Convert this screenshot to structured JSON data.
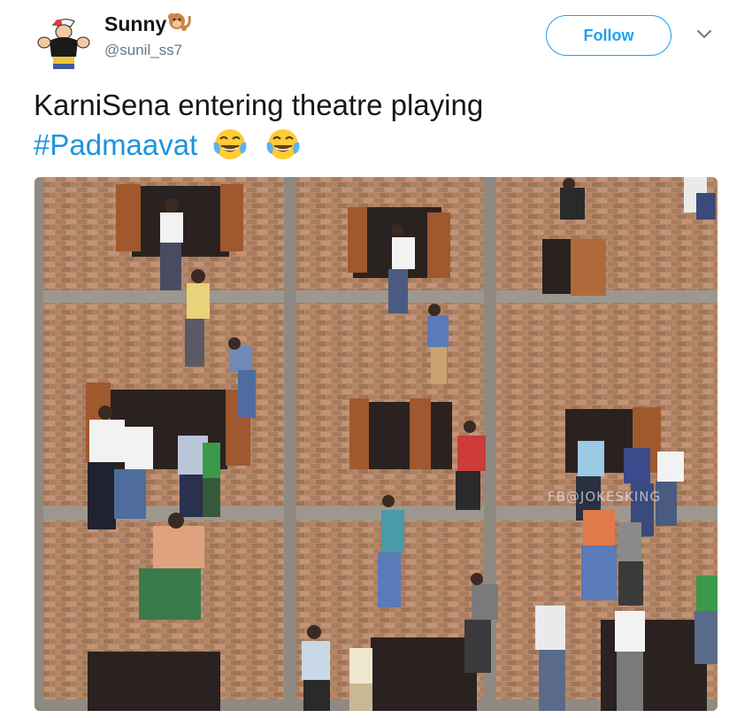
{
  "user": {
    "display_name": "Sunny",
    "handle": "@sunil_ss7",
    "avatar_icon": "cartoon-popeye-avatar",
    "name_emoji_icon": "monkey-emoji"
  },
  "actions": {
    "follow_label": "Follow",
    "menu_icon": "chevron-down-icon"
  },
  "tweet": {
    "text": "KarniSena entering theatre playing",
    "hashtag": "#Padmaavat",
    "emojis": [
      "face-with-tears-of-joy",
      "face-with-tears-of-joy"
    ]
  },
  "media": {
    "description_icon": "photo-men-climbing-brick-building",
    "watermark": "FB@JOKESKING"
  },
  "colors": {
    "accent": "#1da1f2",
    "hashtag": "#1b95e0",
    "text": "#14171a",
    "muted": "#657786"
  }
}
